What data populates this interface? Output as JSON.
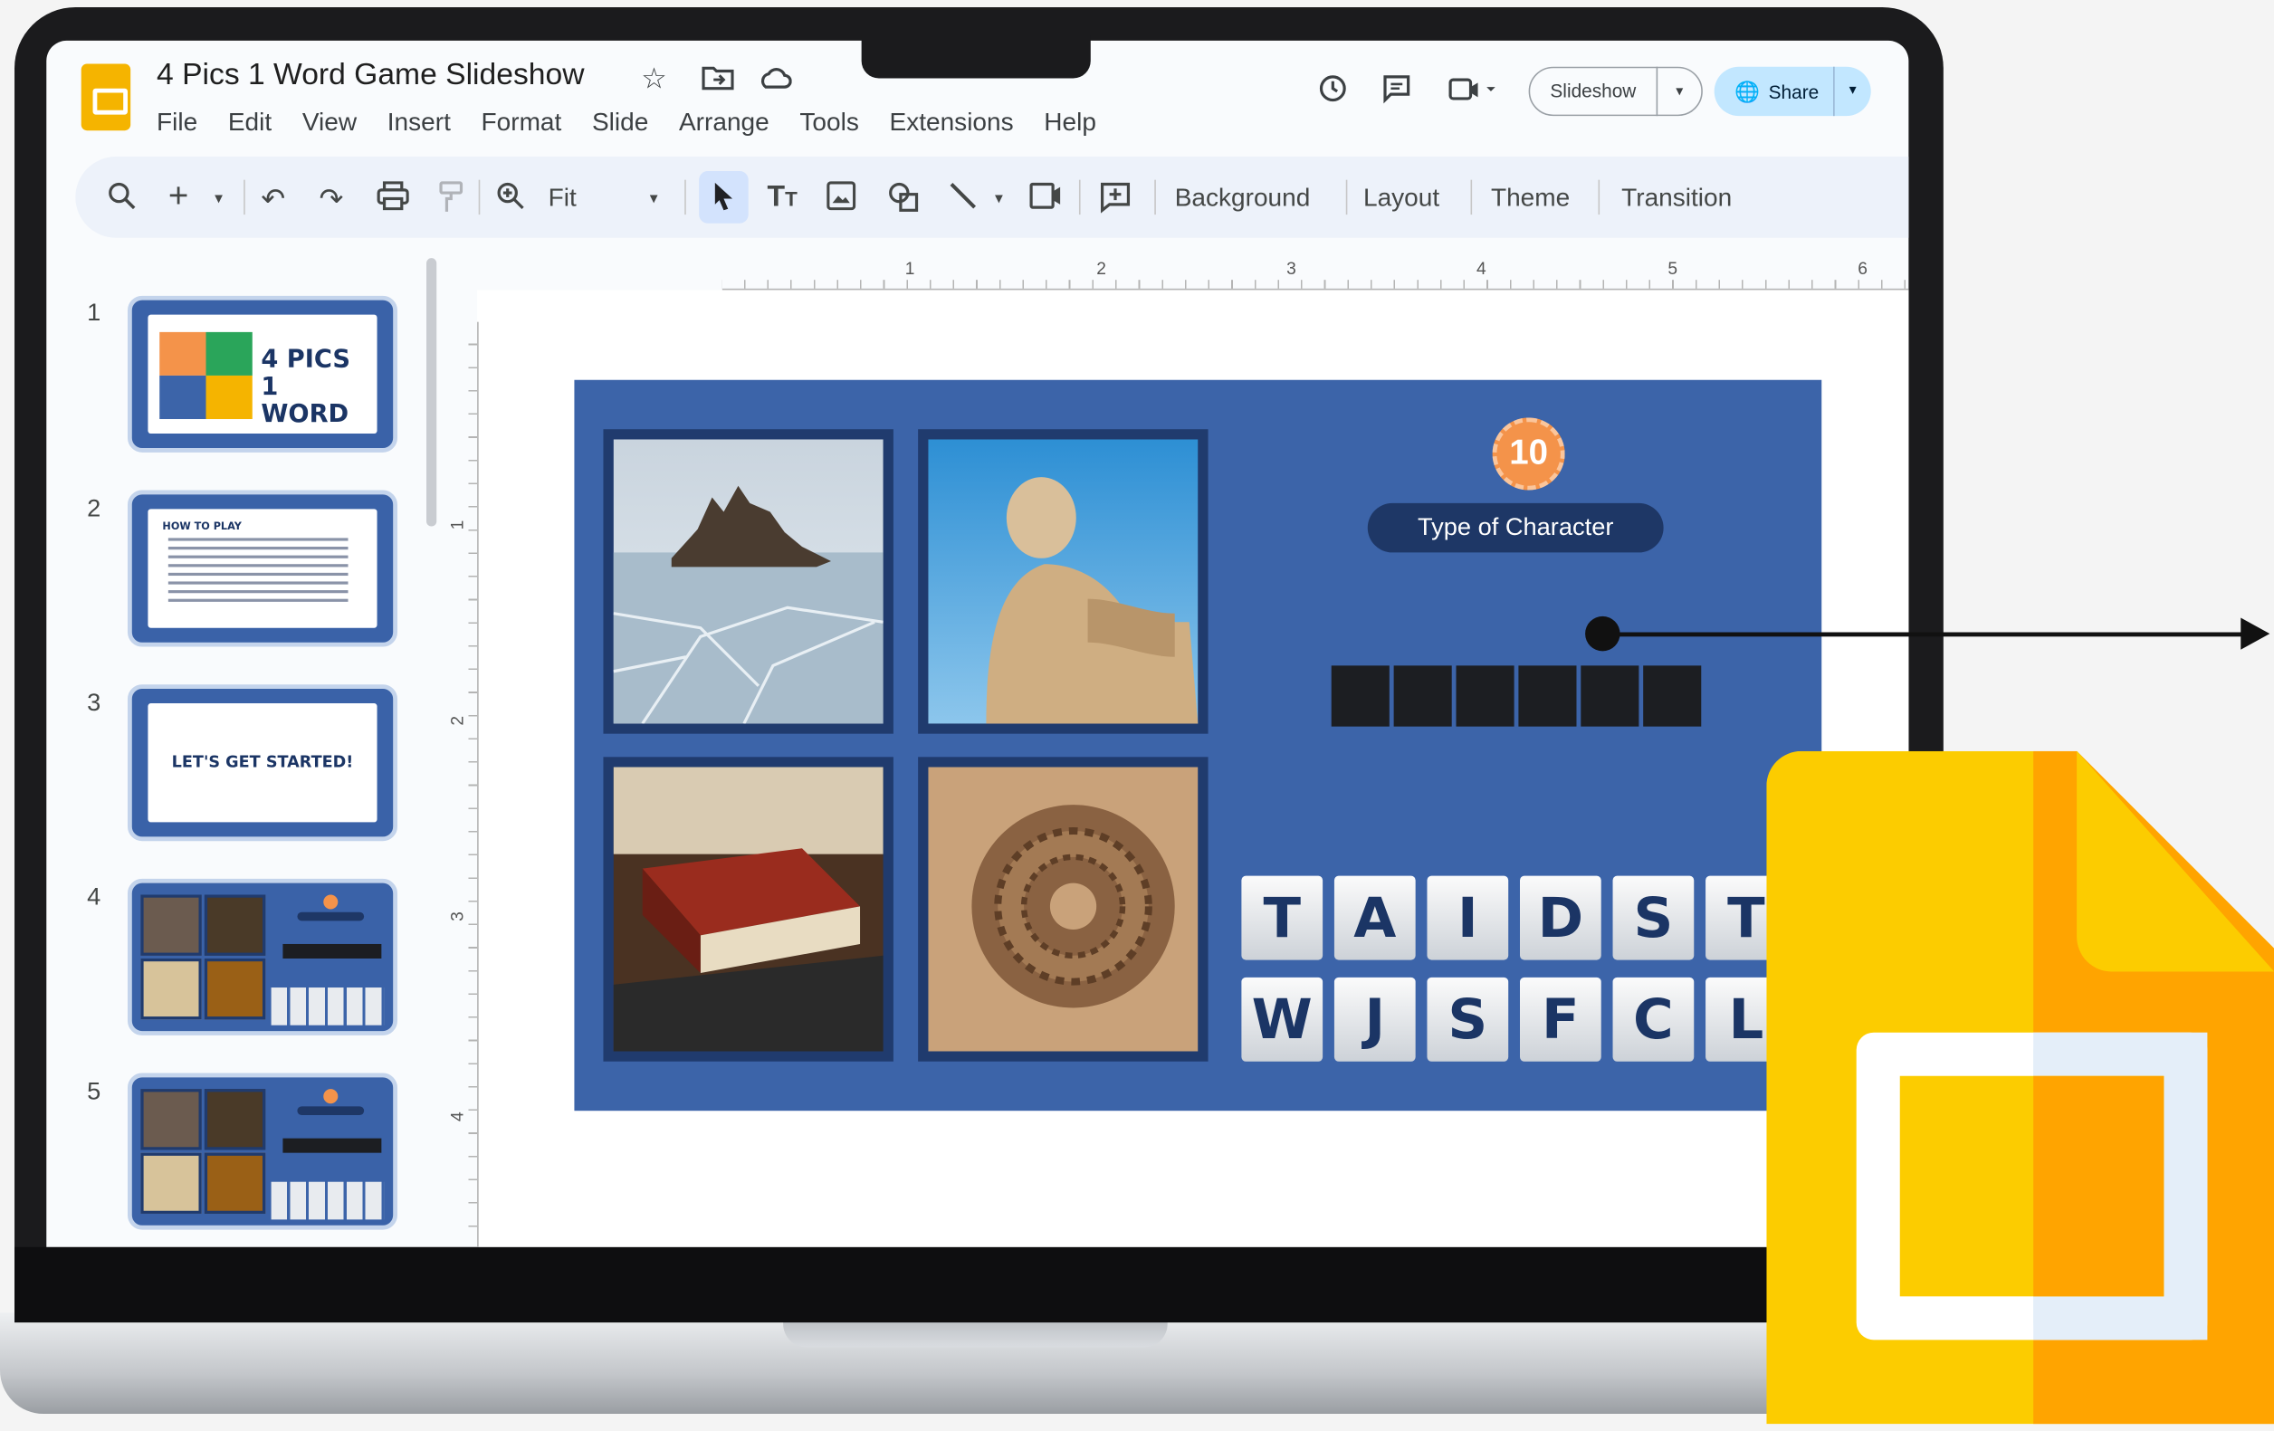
{
  "app": {
    "title": "4 Pics 1 Word Game Slideshow",
    "menu": [
      "File",
      "Edit",
      "View",
      "Insert",
      "Format",
      "Slide",
      "Arrange",
      "Tools",
      "Extensions",
      "Help"
    ],
    "slideshow_label": "Slideshow",
    "share_label": "Share",
    "colors": {
      "accent": "#3c64a9",
      "brand": "#f5b400",
      "share_bg": "#c2e7ff"
    }
  },
  "toolbar": {
    "zoom_label": "Fit",
    "background_label": "Background",
    "layout_label": "Layout",
    "theme_label": "Theme",
    "transition_label": "Transition"
  },
  "ruler": {
    "h": [
      "1",
      "2",
      "3",
      "4",
      "5",
      "6"
    ],
    "v": [
      "1",
      "2",
      "3",
      "4"
    ]
  },
  "filmstrip": [
    {
      "number": "1",
      "title": "4 PICS 1 WORD"
    },
    {
      "number": "2",
      "title": "HOW TO PLAY"
    },
    {
      "number": "3",
      "title": "LET'S GET STARTED!"
    },
    {
      "number": "4"
    },
    {
      "number": "5"
    }
  ],
  "slide": {
    "level": "10",
    "hint": "Type of Character",
    "answer_boxes": 6,
    "letters_row1": [
      "T",
      "A",
      "I",
      "D",
      "S",
      "T"
    ],
    "letters_row2": [
      "W",
      "J",
      "S",
      "F",
      "C",
      "L"
    ],
    "pictures": [
      "frozen-lake-rock",
      "thinker-statue",
      "old-book",
      "ammonite-fossil"
    ]
  }
}
